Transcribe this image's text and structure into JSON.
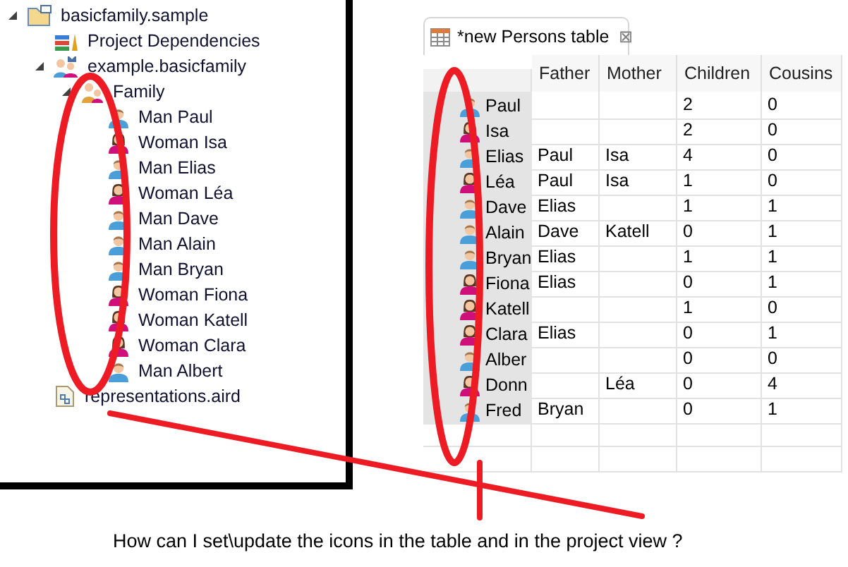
{
  "project_tree": [
    {
      "label": "basicfamily.sample",
      "kind": "project",
      "expanded": true,
      "children": [
        {
          "label": "Project Dependencies",
          "kind": "library"
        },
        {
          "label": "example.basicfamily",
          "kind": "model",
          "expanded": true,
          "children": [
            {
              "label": "Family",
              "kind": "family",
              "expanded": true,
              "children": [
                {
                  "label": "Man Paul",
                  "kind": "man"
                },
                {
                  "label": "Woman Isa",
                  "kind": "woman"
                },
                {
                  "label": "Man Elias",
                  "kind": "man"
                },
                {
                  "label": "Woman Léa",
                  "kind": "woman"
                },
                {
                  "label": "Man Dave",
                  "kind": "man"
                },
                {
                  "label": "Man Alain",
                  "kind": "man"
                },
                {
                  "label": "Man Bryan",
                  "kind": "man"
                },
                {
                  "label": "Woman Fiona",
                  "kind": "woman"
                },
                {
                  "label": "Woman Katell",
                  "kind": "woman"
                },
                {
                  "label": "Woman Clara",
                  "kind": "woman"
                },
                {
                  "label": "Man Albert",
                  "kind": "man"
                }
              ]
            }
          ]
        },
        {
          "label": "representations.aird",
          "kind": "file"
        }
      ]
    }
  ],
  "editor_tab": {
    "title": "*new Persons table",
    "close": "⊠"
  },
  "table": {
    "columns": [
      "Father",
      "Mother",
      "Children",
      "Cousins"
    ],
    "rows": [
      {
        "name": "Paul",
        "kind": "man",
        "cells": [
          "",
          "",
          "2",
          "0"
        ]
      },
      {
        "name": "Isa",
        "kind": "woman",
        "cells": [
          "",
          "",
          "2",
          "0"
        ]
      },
      {
        "name": "Elias",
        "kind": "man",
        "cells": [
          "Paul",
          "Isa",
          "4",
          "0"
        ]
      },
      {
        "name": "Léa",
        "kind": "woman",
        "cells": [
          "Paul",
          "Isa",
          "1",
          "0"
        ]
      },
      {
        "name": "Dave",
        "kind": "man",
        "cells": [
          "Elias",
          "",
          "1",
          "1"
        ]
      },
      {
        "name": "Alain",
        "kind": "man",
        "cells": [
          "Dave",
          "Katell",
          "0",
          "1"
        ]
      },
      {
        "name": "Bryan",
        "kind": "man",
        "cells": [
          "Elias",
          "",
          "1",
          "1"
        ]
      },
      {
        "name": "Fiona",
        "kind": "woman",
        "cells": [
          "Elias",
          "",
          "0",
          "1"
        ]
      },
      {
        "name": "Katell",
        "kind": "woman",
        "cells": [
          "",
          "",
          "1",
          "0"
        ]
      },
      {
        "name": "Clara",
        "kind": "woman",
        "cells": [
          "Elias",
          "",
          "0",
          "1"
        ]
      },
      {
        "name": "Alber",
        "kind": "man",
        "cells": [
          "",
          "",
          "0",
          "0"
        ]
      },
      {
        "name": "Donn",
        "kind": "woman",
        "cells": [
          "",
          "Léa",
          "0",
          "4"
        ]
      },
      {
        "name": "Fred",
        "kind": "man",
        "cells": [
          "Bryan",
          "",
          "0",
          "1"
        ]
      }
    ]
  },
  "question": "How can I set\\update the icons in the table and in the project view ?"
}
